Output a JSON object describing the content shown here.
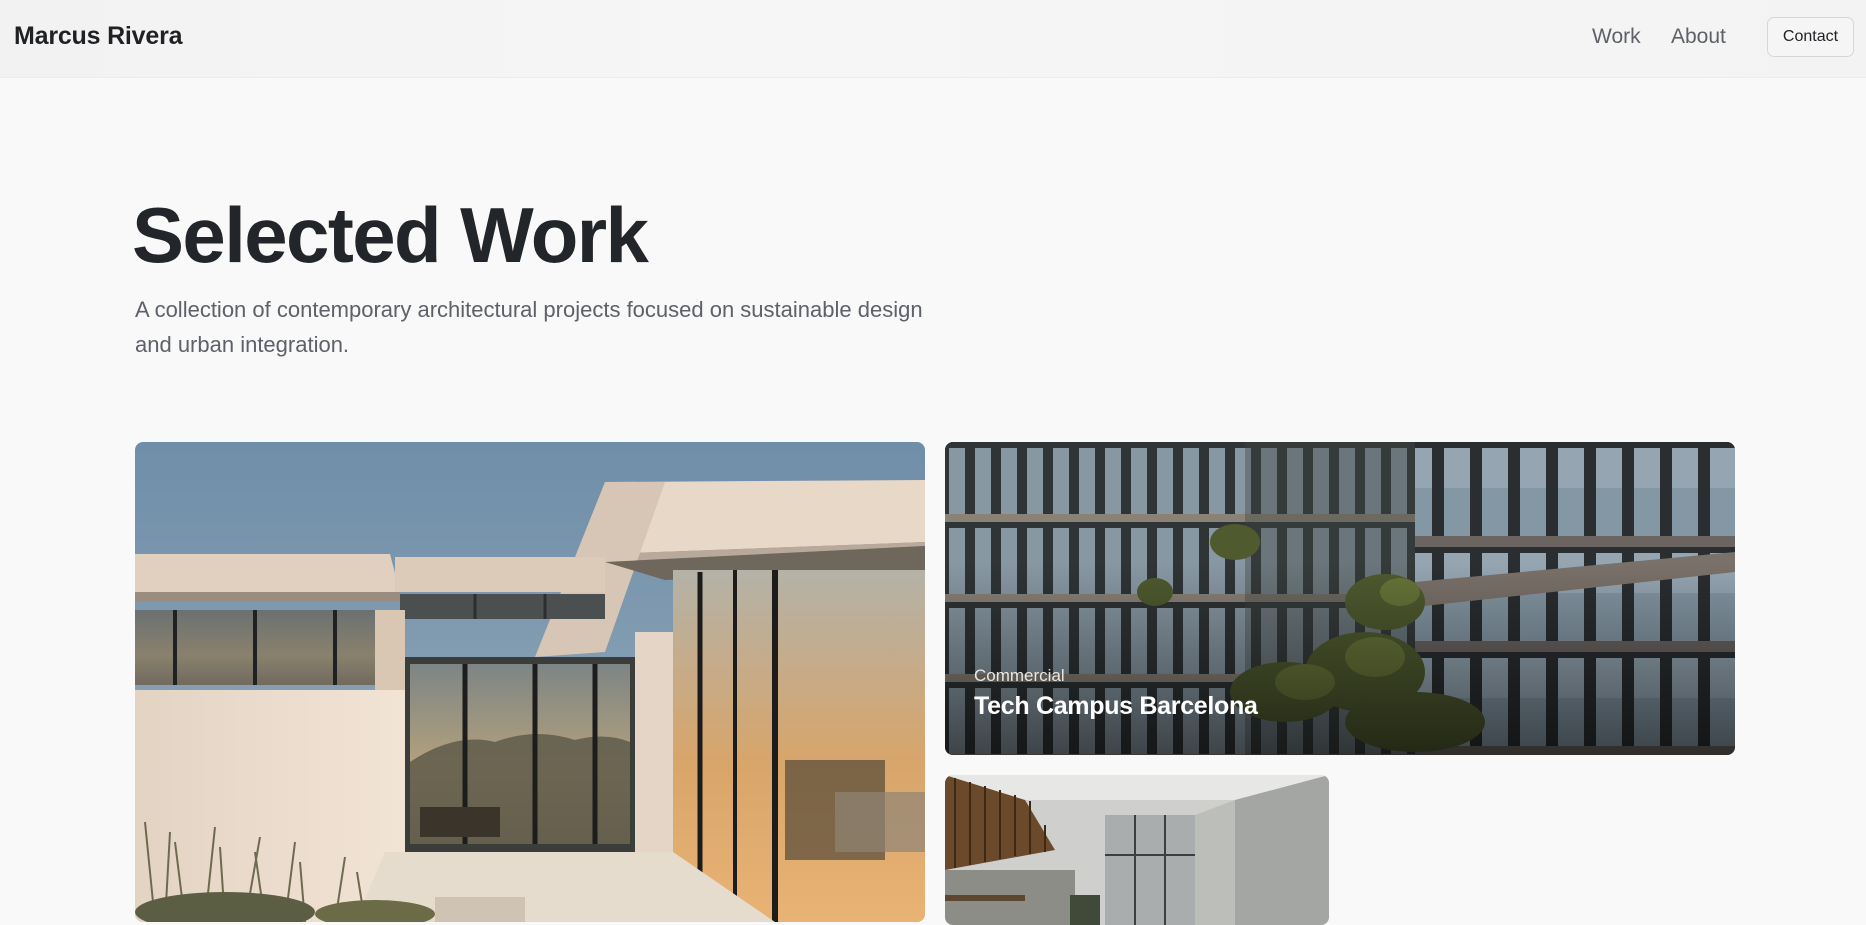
{
  "header": {
    "brand": "Marcus Rivera",
    "nav": {
      "work": "Work",
      "about": "About",
      "contact": "Contact"
    }
  },
  "hero": {
    "title": "Selected Work",
    "subtitle": "A collection of contemporary architectural projects focused on sustainable design and urban integration."
  },
  "projects": [
    {
      "category": "",
      "title": ""
    },
    {
      "category": "Commercial",
      "title": "Tech Campus Barcelona"
    },
    {
      "category": "",
      "title": ""
    }
  ],
  "colors": {
    "background": "#f9f9f9",
    "text_primary": "#22252a",
    "text_muted": "#5d6168",
    "button_border": "#d6d6d6"
  }
}
